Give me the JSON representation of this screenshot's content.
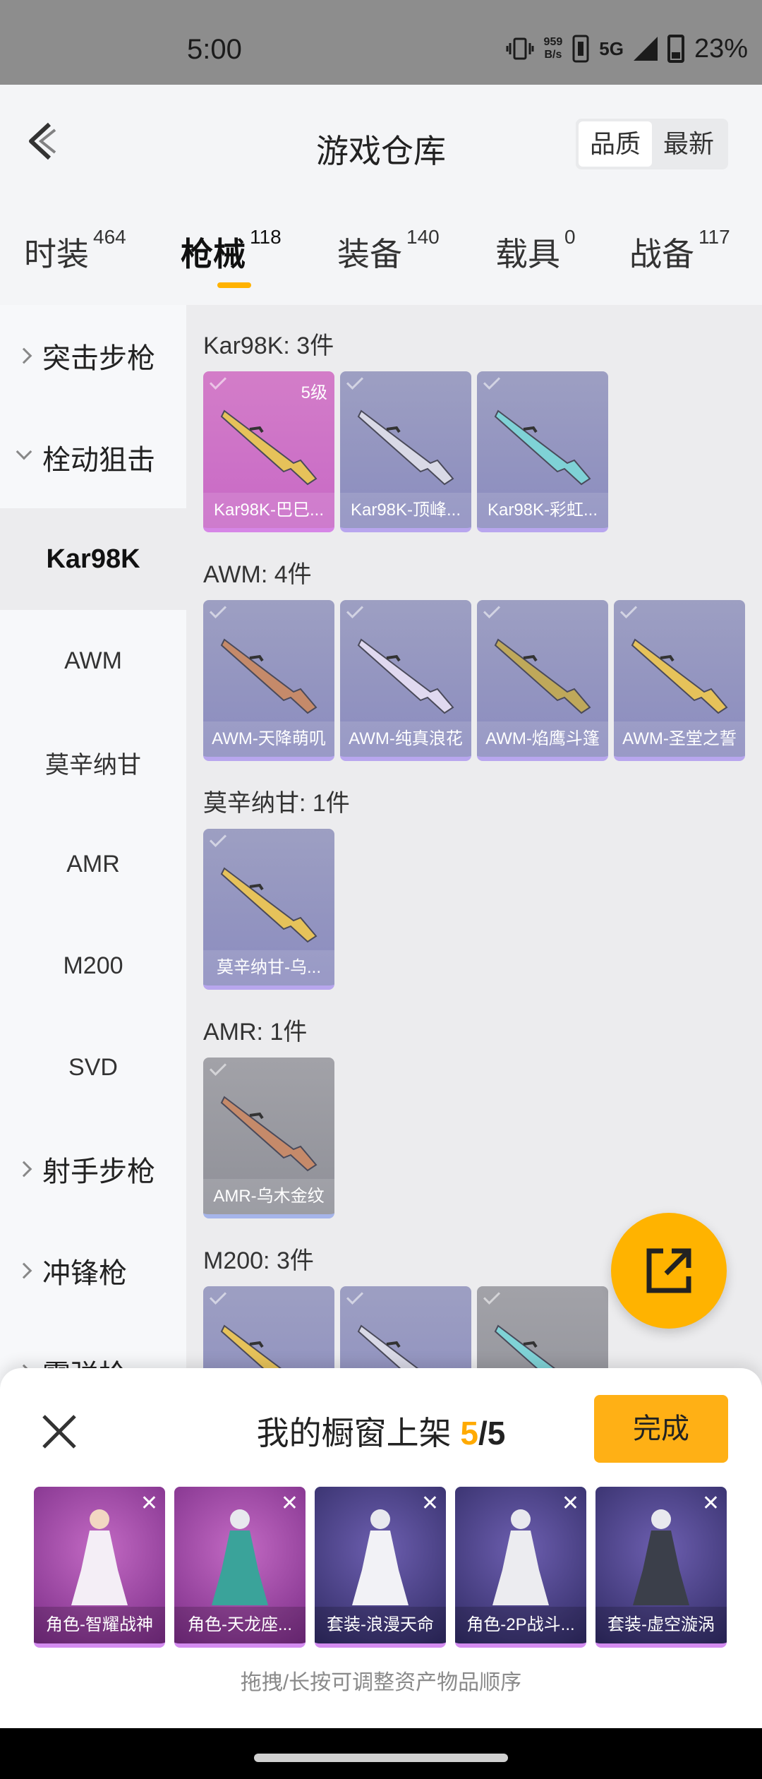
{
  "status_bar": {
    "time": "5:00",
    "speed_value": "959",
    "speed_unit": "B/s",
    "network": "5G",
    "battery": "23%"
  },
  "header": {
    "title": "游戏仓库",
    "sort_options": [
      "品质",
      "最新"
    ],
    "active_sort": "品质"
  },
  "tabs": [
    {
      "label": "时装",
      "count": "464"
    },
    {
      "label": "枪械",
      "count": "118",
      "active": true
    },
    {
      "label": "装备",
      "count": "140"
    },
    {
      "label": "载具",
      "count": "0"
    },
    {
      "label": "战备",
      "count": "117"
    }
  ],
  "sidebar": {
    "groups": [
      {
        "label": "突击步枪",
        "expanded": false
      },
      {
        "label": "栓动狙击",
        "expanded": true
      },
      {
        "label": "射手步枪",
        "expanded": false
      },
      {
        "label": "冲锋枪",
        "expanded": false
      },
      {
        "label": "霰弹枪",
        "expanded": false
      }
    ],
    "subitems": [
      "Kar98K",
      "AWM",
      "莫辛纳甘",
      "AMR",
      "M200",
      "SVD"
    ],
    "active_subitem": "Kar98K"
  },
  "sections": [
    {
      "title": "Kar98K: 3件",
      "items": [
        {
          "caption": "Kar98K-巴巳...",
          "rarity": "pink",
          "level": "5级"
        },
        {
          "caption": "Kar98K-顶峰...",
          "rarity": "purple"
        },
        {
          "caption": "Kar98K-彩虹...",
          "rarity": "purple"
        }
      ]
    },
    {
      "title": "AWM: 4件",
      "items": [
        {
          "caption": "AWM-天降萌叽",
          "rarity": "purple"
        },
        {
          "caption": "AWM-纯真浪花",
          "rarity": "purple"
        },
        {
          "caption": "AWM-焰鹰斗篷",
          "rarity": "purple"
        },
        {
          "caption": "AWM-圣堂之誓",
          "rarity": "purple"
        }
      ]
    },
    {
      "title": "莫辛纳甘: 1件",
      "items": [
        {
          "caption": "莫辛纳甘-乌...",
          "rarity": "purple"
        }
      ]
    },
    {
      "title": "AMR: 1件",
      "items": [
        {
          "caption": "AMR-乌木金纹",
          "rarity": "gray"
        }
      ]
    },
    {
      "title": "M200: 3件",
      "items": [
        {
          "caption": "",
          "rarity": "purple"
        },
        {
          "caption": "",
          "rarity": "purple"
        },
        {
          "caption": "",
          "rarity": "gray"
        }
      ]
    }
  ],
  "sheet": {
    "title": "我的橱窗上架",
    "current": "5",
    "separator": "/",
    "total": "5",
    "done_label": "完成",
    "hint": "拖拽/长按可调整资产物品顺序",
    "items": [
      {
        "caption": "角色-智耀战神",
        "bg": "purple"
      },
      {
        "caption": "角色-天龙座...",
        "bg": "purple"
      },
      {
        "caption": "套装-浪漫天命",
        "bg": "blue"
      },
      {
        "caption": "角色-2P战斗...",
        "bg": "blue"
      },
      {
        "caption": "套装-虚空漩涡",
        "bg": "blue"
      }
    ]
  },
  "colors": {
    "accent": "#ffb300",
    "pink_rarity": "#c869c6",
    "purple_rarity": "#8b8cbf",
    "gray_rarity": "#8f9098"
  }
}
